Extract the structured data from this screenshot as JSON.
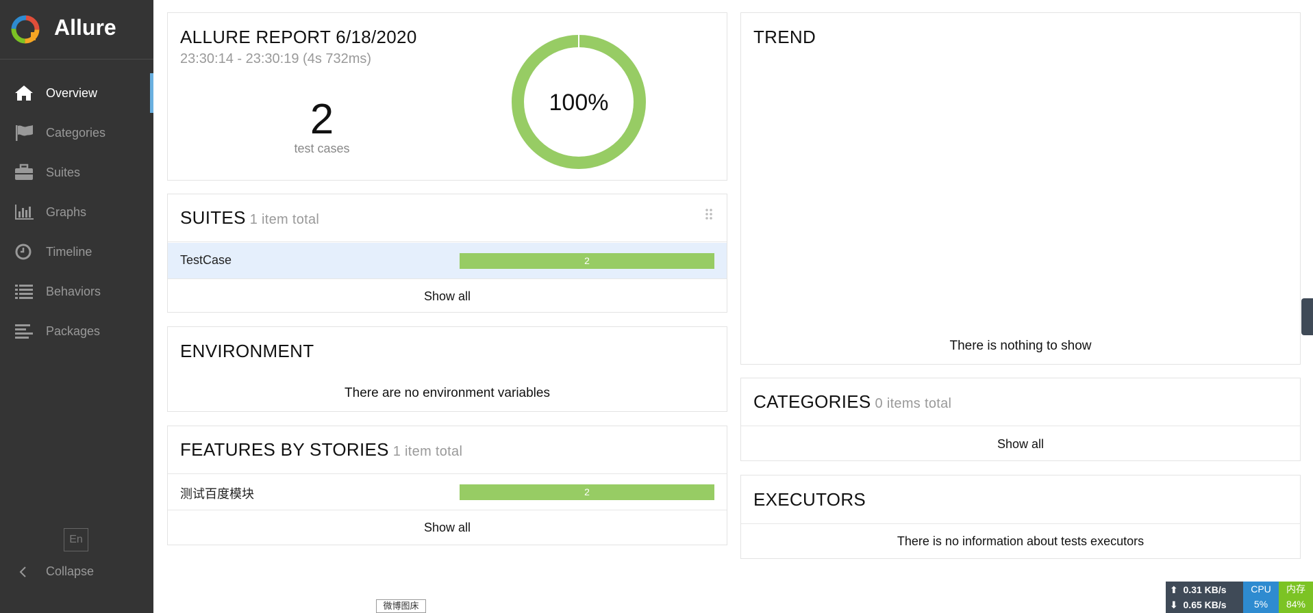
{
  "sidebar": {
    "brand": "Allure",
    "items": [
      {
        "label": "Overview",
        "icon": "home-icon"
      },
      {
        "label": "Categories",
        "icon": "flag-icon"
      },
      {
        "label": "Suites",
        "icon": "briefcase-icon"
      },
      {
        "label": "Graphs",
        "icon": "bar-chart-icon"
      },
      {
        "label": "Timeline",
        "icon": "clock-icon"
      },
      {
        "label": "Behaviors",
        "icon": "list-icon"
      },
      {
        "label": "Packages",
        "icon": "align-left-icon"
      }
    ],
    "active_index": 0,
    "language": "En",
    "collapse_label": "Collapse"
  },
  "summary": {
    "title": "ALLURE REPORT 6/18/2020",
    "time_range": "23:30:14 - 23:30:19 (4s 732ms)",
    "test_case_count": "2",
    "test_case_label": "test cases",
    "pass_rate": "100%",
    "pass_fraction": 1.0,
    "pass_color": "#97cc64"
  },
  "suites": {
    "title": "SUITES",
    "subtitle": "1 item total",
    "rows": [
      {
        "name": "TestCase",
        "count": "2",
        "fraction": 1.0
      }
    ],
    "show_all": "Show all"
  },
  "environment": {
    "title": "ENVIRONMENT",
    "message": "There are no environment variables"
  },
  "features": {
    "title": "FEATURES BY STORIES",
    "subtitle": "1 item total",
    "rows": [
      {
        "name": "测试百度模块",
        "count": "2",
        "fraction": 1.0
      }
    ],
    "show_all": "Show all"
  },
  "trend": {
    "title": "TREND",
    "message": "There is nothing to show"
  },
  "categories": {
    "title": "CATEGORIES",
    "subtitle": "0 items total",
    "show_all": "Show all"
  },
  "executors": {
    "title": "EXECUTORS",
    "message": "There is no information about tests executors"
  },
  "overlay": {
    "tooltip": "微博图床",
    "upload": "0.31 KB/s",
    "download": "0.65 KB/s",
    "cpu_label": "CPU",
    "cpu_value": "5%",
    "mem_label": "内存",
    "mem_value": "84%"
  }
}
